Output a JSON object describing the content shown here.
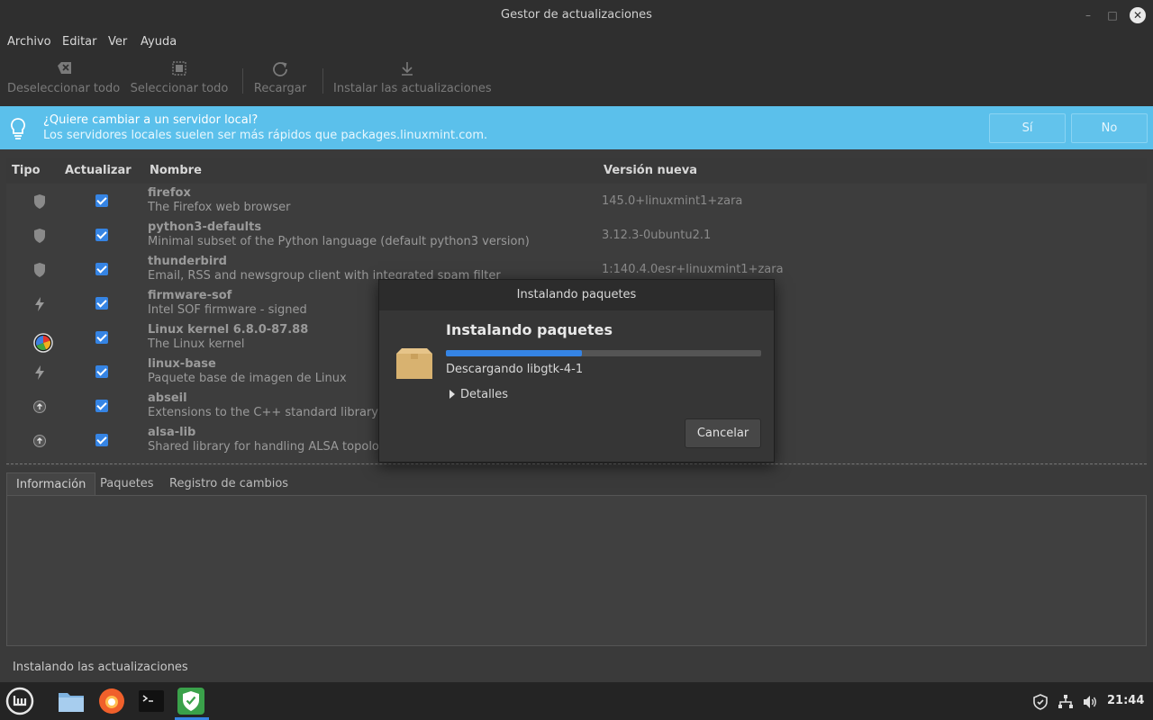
{
  "window": {
    "title": "Gestor de actualizaciones",
    "minimize_glyph": "–",
    "maximize_glyph": "□",
    "close_glyph": "✕"
  },
  "menu": [
    "Archivo",
    "Editar",
    "Ver",
    "Ayuda"
  ],
  "toolbar": {
    "deselect": "Deseleccionar todo",
    "select": "Seleccionar todo",
    "reload": "Recargar",
    "install": "Instalar las actualizaciones"
  },
  "infobar": {
    "question": "¿Quiere cambiar a un servidor local?",
    "subtitle": "Los servidores locales suelen ser más rápidos que packages.linuxmint.com.",
    "yes": "Sí",
    "no": "No",
    "color": "#5bc0eb"
  },
  "table": {
    "headers": {
      "tipo": "Tipo",
      "actualizar": "Actualizar",
      "nombre": "Nombre",
      "version": "Versión nueva"
    },
    "rows": [
      {
        "type_icon": "shield-icon",
        "checked": true,
        "name": "firefox",
        "description": "The Firefox web browser",
        "version": "145.0+linuxmint1+zara"
      },
      {
        "type_icon": "shield-icon",
        "checked": true,
        "name": "python3-defaults",
        "description": "Minimal subset of the Python language (default python3 version)",
        "version": "3.12.3-0ubuntu2.1"
      },
      {
        "type_icon": "shield-icon",
        "checked": true,
        "name": "thunderbird",
        "description": "Email, RSS and newsgroup client with integrated spam filter",
        "version": "1:140.4.0esr+linuxmint1+zara"
      },
      {
        "type_icon": "lightning-icon",
        "checked": true,
        "name": "firmware-sof",
        "description": "Intel SOF firmware - signed",
        "version": ""
      },
      {
        "type_icon": "lightning-icon",
        "checked": true,
        "name": "Linux kernel 6.8.0-87.88",
        "description": "The Linux kernel",
        "version": ""
      },
      {
        "type_icon": "lightning-icon",
        "checked": true,
        "name": "linux-base",
        "description": "Paquete base de imagen de Linux",
        "version": ""
      },
      {
        "type_icon": "arrow-up-circle-icon",
        "checked": true,
        "name": "abseil",
        "description": "Extensions to the C++ standard library",
        "version": ""
      },
      {
        "type_icon": "arrow-up-circle-icon",
        "checked": true,
        "name": "alsa-lib",
        "description": "Shared library for handling ALSA topology definitions",
        "version": ""
      }
    ]
  },
  "tabs": [
    "Información",
    "Paquetes",
    "Registro de cambios"
  ],
  "status": "Instalando las actualizaciones",
  "dialog": {
    "title": "Instalando paquetes",
    "heading": "Instalando paquetes",
    "progress": 0.43,
    "progress_text": "Descargando libgtk-4-1",
    "details": "Detalles",
    "cancel": "Cancelar",
    "accent": "#3584e4"
  },
  "taskbar": {
    "clock": "21:44",
    "apps": [
      "mint-menu-icon",
      "files-icon",
      "firefox-icon",
      "terminal-icon",
      "update-manager-icon"
    ]
  }
}
